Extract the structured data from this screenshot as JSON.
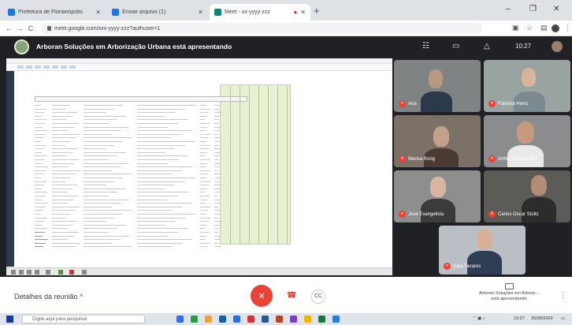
{
  "browser": {
    "tabs": [
      {
        "title": "Prefeitura de Florianópolis",
        "favicon_color": "#1a73e8"
      },
      {
        "title": "Enviar arquivo (1)",
        "favicon_color": "#1a73e8"
      },
      {
        "title": "Meet - xx-yyyy-zzz",
        "favicon_color": "#00897b"
      }
    ],
    "new_tab": "+",
    "window_controls": [
      "–",
      "❐",
      "✕"
    ],
    "back": "←",
    "forward": "→",
    "reload": "C",
    "url": "meet.google.com/xxx-yyyy-zzz?authuser=1"
  },
  "meet": {
    "presenter_banner": "Arboran Soluções em Arborização Urbana está apresentando",
    "clock": "10:27",
    "participants": [
      {
        "name": "Ana",
        "bg": "#7f8383",
        "skin": "#b99882",
        "shirt": "#2a3a4a"
      },
      {
        "name": "Fabiana Heinz",
        "bg": "#99a4a0",
        "skin": "#d8b49a",
        "shirt": "#7a8a90"
      },
      {
        "name": "Marisa Rorig",
        "bg": "#7b7166",
        "skin": "#c3a08a",
        "shirt": "#4a3c34"
      },
      {
        "name": "Arthur Vinicius Prá",
        "bg": "#8a8c8e",
        "skin": "#c79a80",
        "shirt": "#e9e9e9"
      },
      {
        "name": "José Evangelista",
        "bg": "#8e8e8e",
        "skin": "#d8b5a0",
        "shirt": "#3b3b3b"
      },
      {
        "name": "Carlos Oscar Stoltz",
        "bg": "#5d5b57",
        "skin": "#b08d74",
        "shirt": "#2c2c2c"
      },
      {
        "name": "Sara Tavares",
        "bg": "#b9bfc4",
        "skin": "#d6b197",
        "shirt": "#2f3d55"
      }
    ]
  },
  "controls": {
    "meeting_details": "Detalhes da reunião",
    "presenting_line1": "Arboran Soluções em Arboriz...",
    "presenting_line2": "está apresentando"
  },
  "taskbar": {
    "search_placeholder": "Digite aqui para pesquisar",
    "time": "10:27",
    "date": "26/08/2020"
  }
}
